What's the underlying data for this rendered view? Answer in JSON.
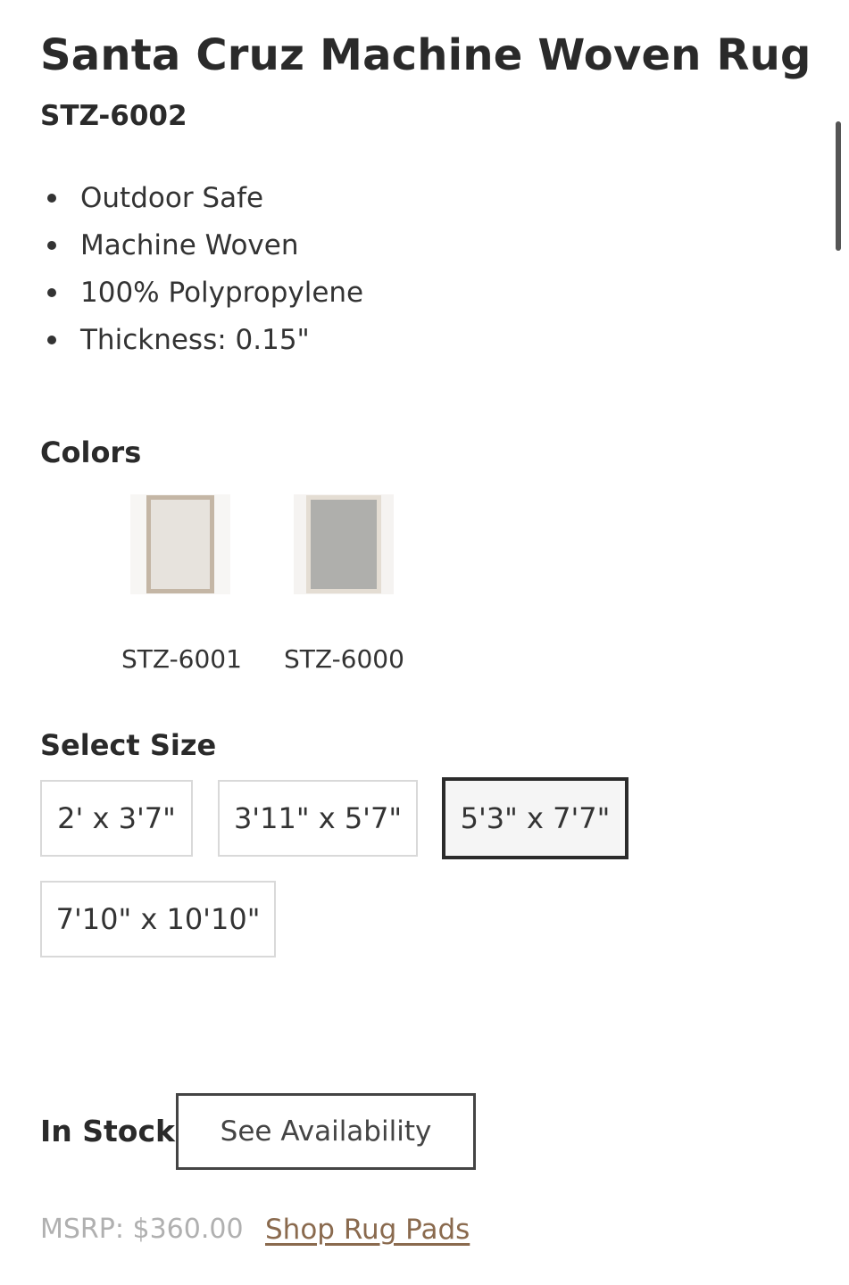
{
  "product": {
    "title": "Santa Cruz Machine Woven Rug",
    "sku": "STZ-6002",
    "features": [
      "Outdoor Safe",
      "Machine Woven",
      "100% Polypropylene",
      "Thickness: 0.15\""
    ]
  },
  "colors": {
    "label": "Colors",
    "options": [
      {
        "label": "STZ-6001",
        "icon": "beige-bordered-rug-swatch"
      },
      {
        "label": "STZ-6000",
        "icon": "gray-bordered-rug-swatch"
      }
    ]
  },
  "sizes": {
    "label": "Select Size",
    "options": [
      "2' x 3'7\"",
      "3'11\" x 5'7\"",
      "5'3\" x 7'7\"",
      "7'10\" x 10'10\""
    ],
    "selected": "5'3\" x 7'7\""
  },
  "availability": {
    "status": "In Stock",
    "button_label": "See Availability"
  },
  "pricing": {
    "msrp": "MSRP: $360.00",
    "rug_pads_link": "Shop Rug Pads"
  },
  "colors_palette": {
    "link": "#8a6a4e",
    "text": "#2a2a2a",
    "muted": "#b0b0b0"
  }
}
